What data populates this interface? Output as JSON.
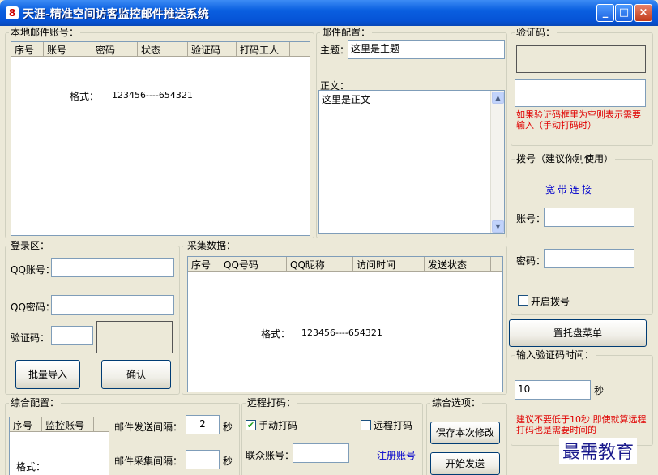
{
  "window": {
    "title": "天涯-精准空间访客监控邮件推送系统",
    "app_icon": "8"
  },
  "local_accounts": {
    "label": "本地邮件账号：",
    "columns": [
      "序号",
      "账号",
      "密码",
      "状态",
      "验证码",
      "打码工人"
    ],
    "format_label": "格式：",
    "format_value": "123456----654321"
  },
  "mail_config": {
    "label": "邮件配置：",
    "subject_label": "主题：",
    "subject_value": "这里是主题",
    "body_label": "正文：",
    "body_value": "这里是正文"
  },
  "captcha": {
    "label": "验证码：",
    "note": "如果验证码框里为空则表示需要输入（手动打码时）"
  },
  "dialup": {
    "label": "拨号（建议你别使用）",
    "broadband": "宽带连接",
    "account_label": "账号：",
    "password_label": "密码：",
    "enable_label": "开启拨号"
  },
  "tray_button": "置托盘菜单",
  "captcha_time": {
    "label": "输入验证码时间：",
    "value": "10",
    "unit": "秒",
    "note": "建议不要低于10秒 即使就算远程打码也是需要时间的"
  },
  "login": {
    "label": "登录区：",
    "qq_label": "QQ账号：",
    "pwd_label": "QQ密码：",
    "captcha_label": "验证码：",
    "import_button": "批量导入",
    "confirm_button": "确认"
  },
  "collected": {
    "label": "采集数据：",
    "columns": [
      "序号",
      "QQ号码",
      "QQ昵称",
      "访问时间",
      "发送状态"
    ],
    "format_label": "格式：",
    "format_value": "123456----654321"
  },
  "general": {
    "label": "综合配置：",
    "columns": [
      "序号",
      "监控账号"
    ],
    "format_label": "格式：",
    "send_interval_label": "邮件发送间隔：",
    "send_interval_value": "2",
    "collect_interval_label": "邮件采集间隔：",
    "collect_interval_value": "",
    "unit": "秒"
  },
  "remote": {
    "label": "远程打码：",
    "manual_label": "手动打码",
    "manual_checked": true,
    "remote_label": "远程打码",
    "remote_checked": false,
    "account_label": "联众账号：",
    "register_link": "注册账号"
  },
  "options": {
    "label": "综合选项：",
    "save_button": "保存本次修改",
    "start_button": "开始发送"
  },
  "watermark": "最需教育"
}
